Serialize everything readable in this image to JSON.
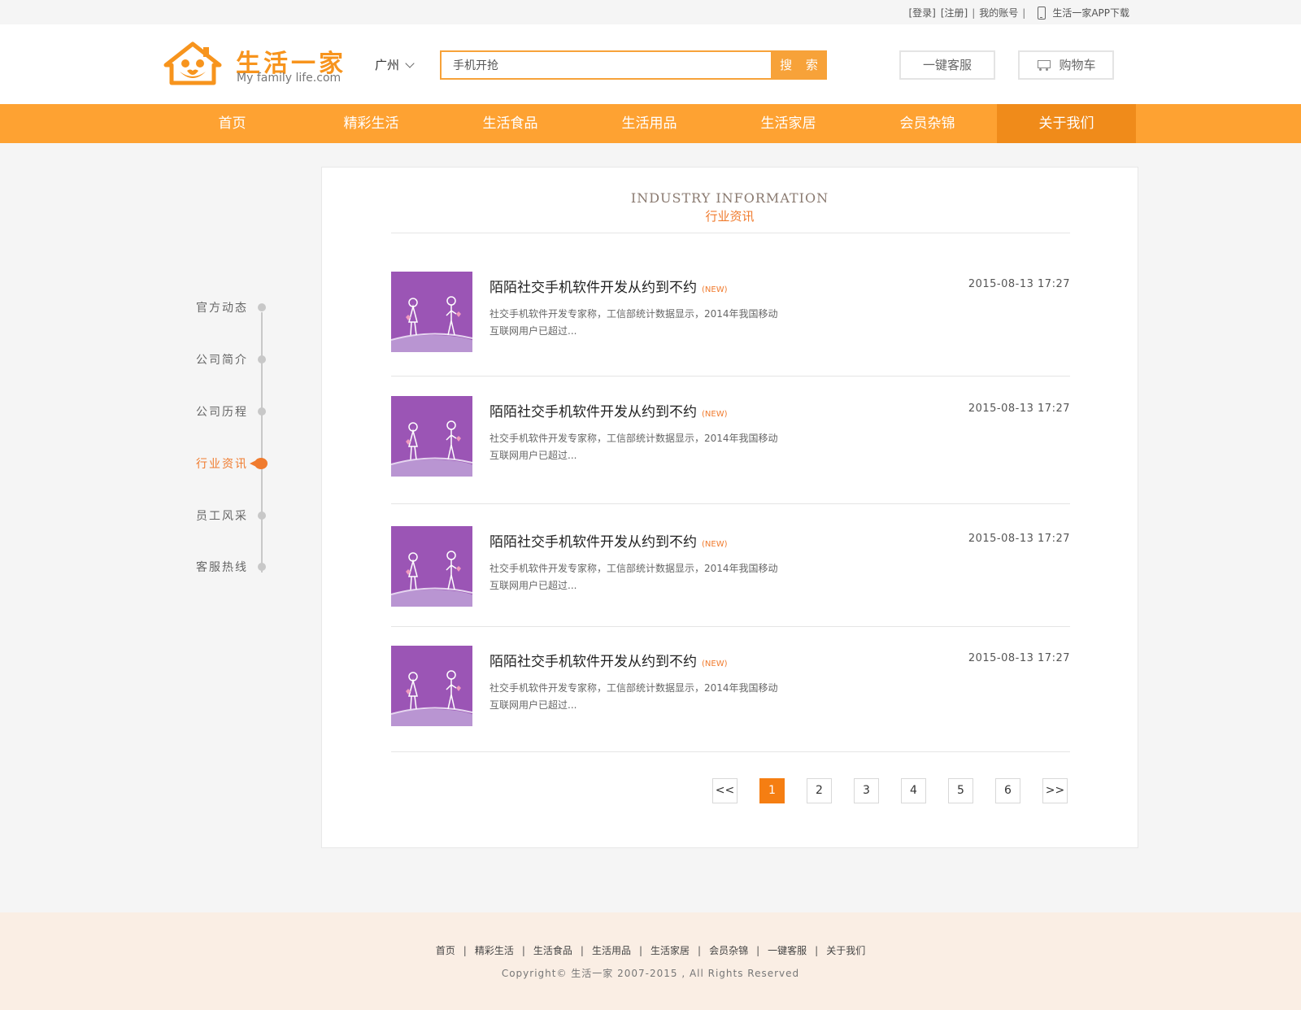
{
  "topbar": {
    "login": "[登录]",
    "register": "[注册]",
    "sep": "|",
    "account": "我的账号",
    "app_download": "生活一家APP下载",
    "icon": "phone-icon"
  },
  "header": {
    "logo_text": "生活一家",
    "logo_sub": "My family life.com",
    "city": "广州",
    "search_placeholder": "手机开抢",
    "search_button": "搜 索",
    "service_button": "一键客服",
    "cart_button": "购物车",
    "accent_color": "#f7a239"
  },
  "nav": {
    "items": [
      {
        "label": "首页"
      },
      {
        "label": "精彩生活"
      },
      {
        "label": "生活食品"
      },
      {
        "label": "生活用品"
      },
      {
        "label": "生活家居"
      },
      {
        "label": "会员杂锦"
      },
      {
        "label": "关于我们"
      }
    ],
    "active_index": 6,
    "bg_color": "#fea232",
    "active_color": "#f08b1a"
  },
  "sidebar": {
    "items": [
      {
        "label": "官方动态"
      },
      {
        "label": "公司简介"
      },
      {
        "label": "公司历程"
      },
      {
        "label": "行业资讯"
      },
      {
        "label": "员工风采"
      },
      {
        "label": "客服热线"
      }
    ],
    "active_index": 3
  },
  "panel": {
    "title_en": "INDUSTRY INFORMATION",
    "title_cn": "行业资讯",
    "news": [
      {
        "title": "陌陌社交手机软件开发从约到不约",
        "badge": "(NEW)",
        "date": "2015-08-13 17:27",
        "desc": "社交手机软件开发专家称，工信部统计数据显示，2014年我国移动互联网用户已超过..."
      },
      {
        "title": "陌陌社交手机软件开发从约到不约",
        "badge": "(NEW)",
        "date": "2015-08-13 17:27",
        "desc": "社交手机软件开发专家称，工信部统计数据显示，2014年我国移动互联网用户已超过..."
      },
      {
        "title": "陌陌社交手机软件开发从约到不约",
        "badge": "(NEW)",
        "date": "2015-08-13 17:27",
        "desc": "社交手机软件开发专家称，工信部统计数据显示，2014年我国移动互联网用户已超过..."
      },
      {
        "title": "陌陌社交手机软件开发从约到不约",
        "badge": "(NEW)",
        "date": "2015-08-13 17:27",
        "desc": "社交手机软件开发专家称，工信部统计数据显示，2014年我国移动互联网用户已超过..."
      }
    ],
    "pager": {
      "prev": "<<",
      "pages": [
        "1",
        "2",
        "3",
        "4",
        "5",
        "6"
      ],
      "next": ">>",
      "current": "1"
    }
  },
  "footer": {
    "links": [
      "首页",
      "精彩生活",
      "生活食品",
      "生活用品",
      "生活家居",
      "会员杂锦",
      "一键客服",
      "关于我们"
    ],
    "sep": "|",
    "copyright": "Copyright© 生活一家 2007-2015 , All Rights Reserved"
  }
}
